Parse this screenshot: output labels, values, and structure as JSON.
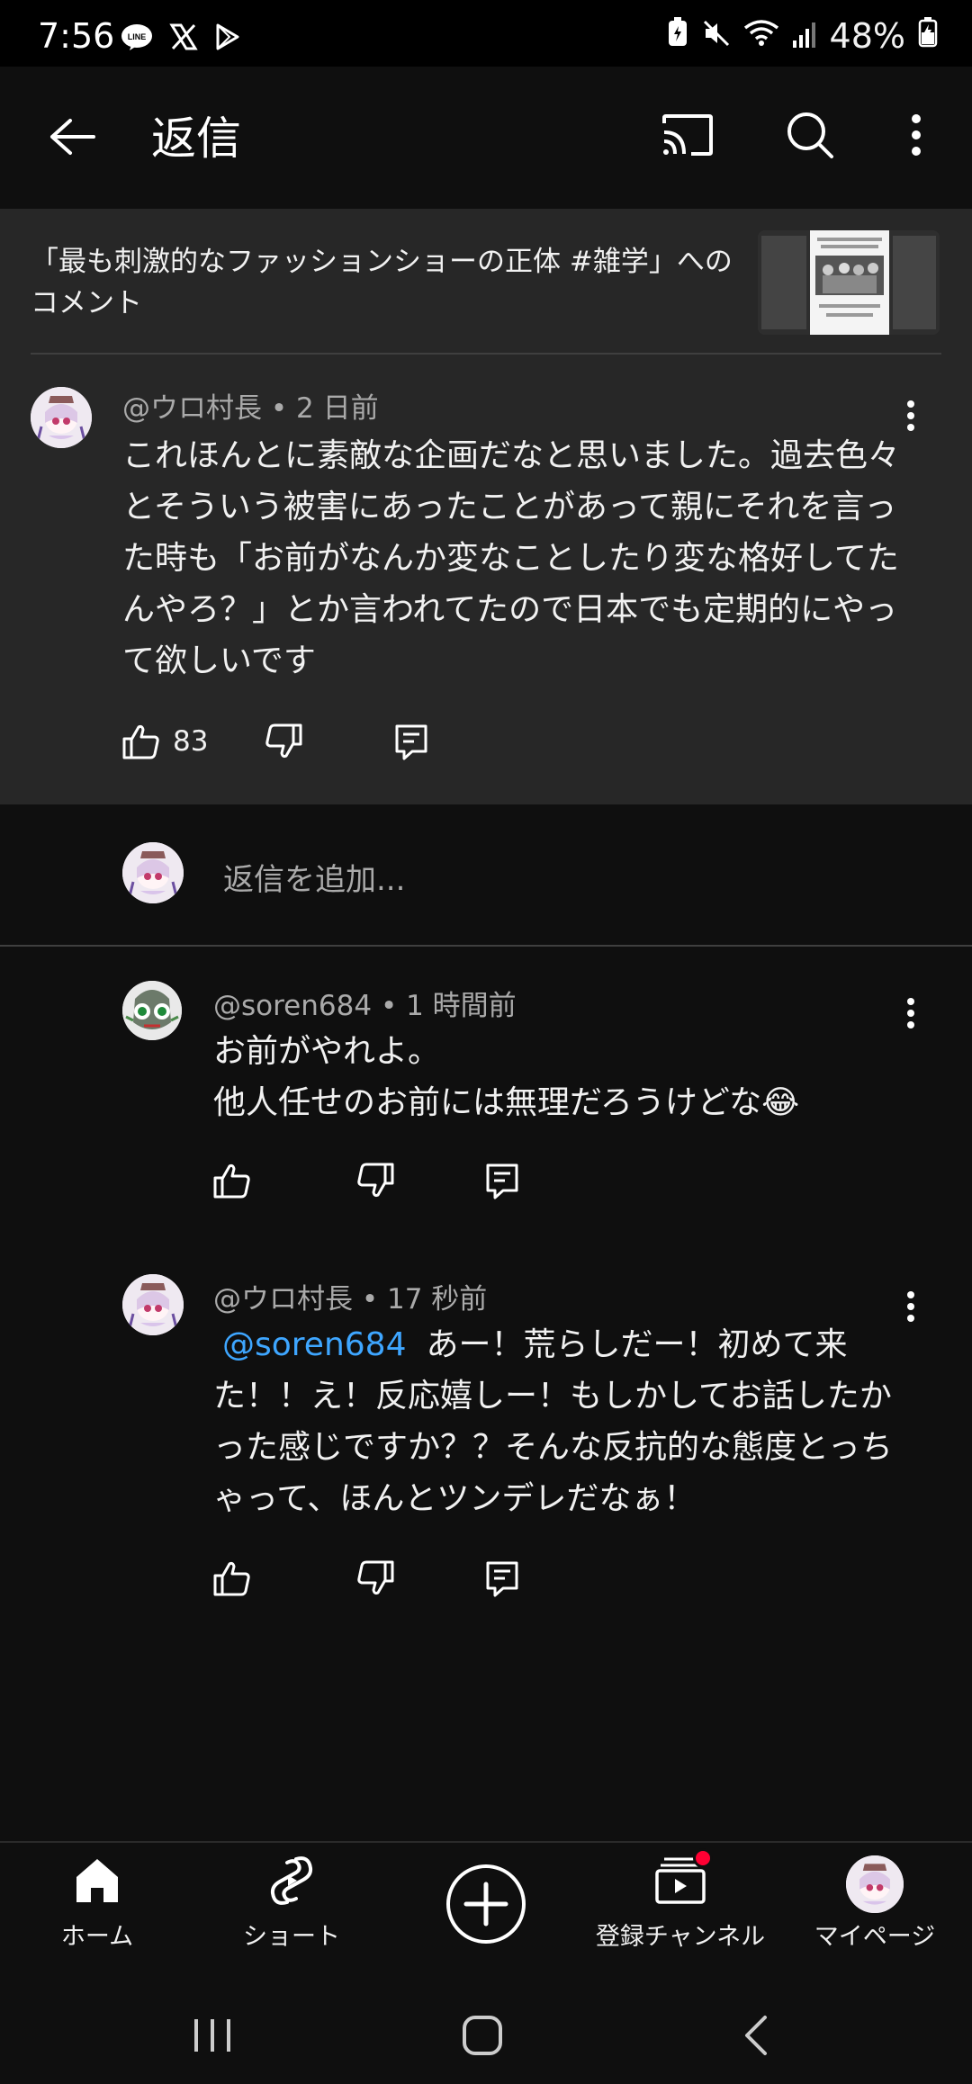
{
  "status_bar": {
    "time": "7:56",
    "battery": "48%",
    "app_icons": [
      "line-icon",
      "x-icon",
      "play-store-icon"
    ]
  },
  "header": {
    "title": "返信",
    "icons": [
      "back-arrow-icon",
      "cast-icon",
      "search-icon",
      "more-vert-icon"
    ]
  },
  "video_context": {
    "text": "「最も刺激的なファッションショーの正体 #雑学」へのコメント",
    "thumbnail_icon": "video-thumbnail"
  },
  "parent_comment": {
    "author": "@ウロ村長",
    "time": "2 日前",
    "body": "これほんとに素敵な企画だなと思いました。過去色々とそういう被害にあったことがあって親にそれを言った時も「お前がなんか変なことしたり変な格好してたんやろ？」とか言われてたので日本でも定期的にやって欲しいです",
    "likes": "83"
  },
  "reply_input": {
    "placeholder": "返信を追加..."
  },
  "replies": [
    {
      "author": "@soren684",
      "time": "1 時間前",
      "line1": "お前がやれよ。",
      "line2": "他人任せのお前には無理だろうけどな😂"
    },
    {
      "author": "@ウロ村長",
      "time": "17 秒前",
      "mention": "@soren684",
      "body": "あー！荒らしだー！初めて来た！！え！反応嬉しー！もしかしてお話したかった感じですか？？そんな反抗的な態度とっちゃって、ほんとツンデレだなぁ！"
    }
  ],
  "bottom_nav": {
    "items": [
      {
        "label": "ホーム",
        "icon": "home-icon"
      },
      {
        "label": "ショート",
        "icon": "shorts-icon"
      },
      {
        "label": "",
        "icon": "create-plus-icon"
      },
      {
        "label": "登録チャンネル",
        "icon": "subscriptions-icon"
      },
      {
        "label": "マイページ",
        "icon": "avatar"
      }
    ],
    "notification_color": "#ff0033"
  },
  "colors": {
    "background": "#0f0f0f",
    "panel": "#272727",
    "mention": "#3ea6ff",
    "secondary_text": "#aaaaaa"
  }
}
